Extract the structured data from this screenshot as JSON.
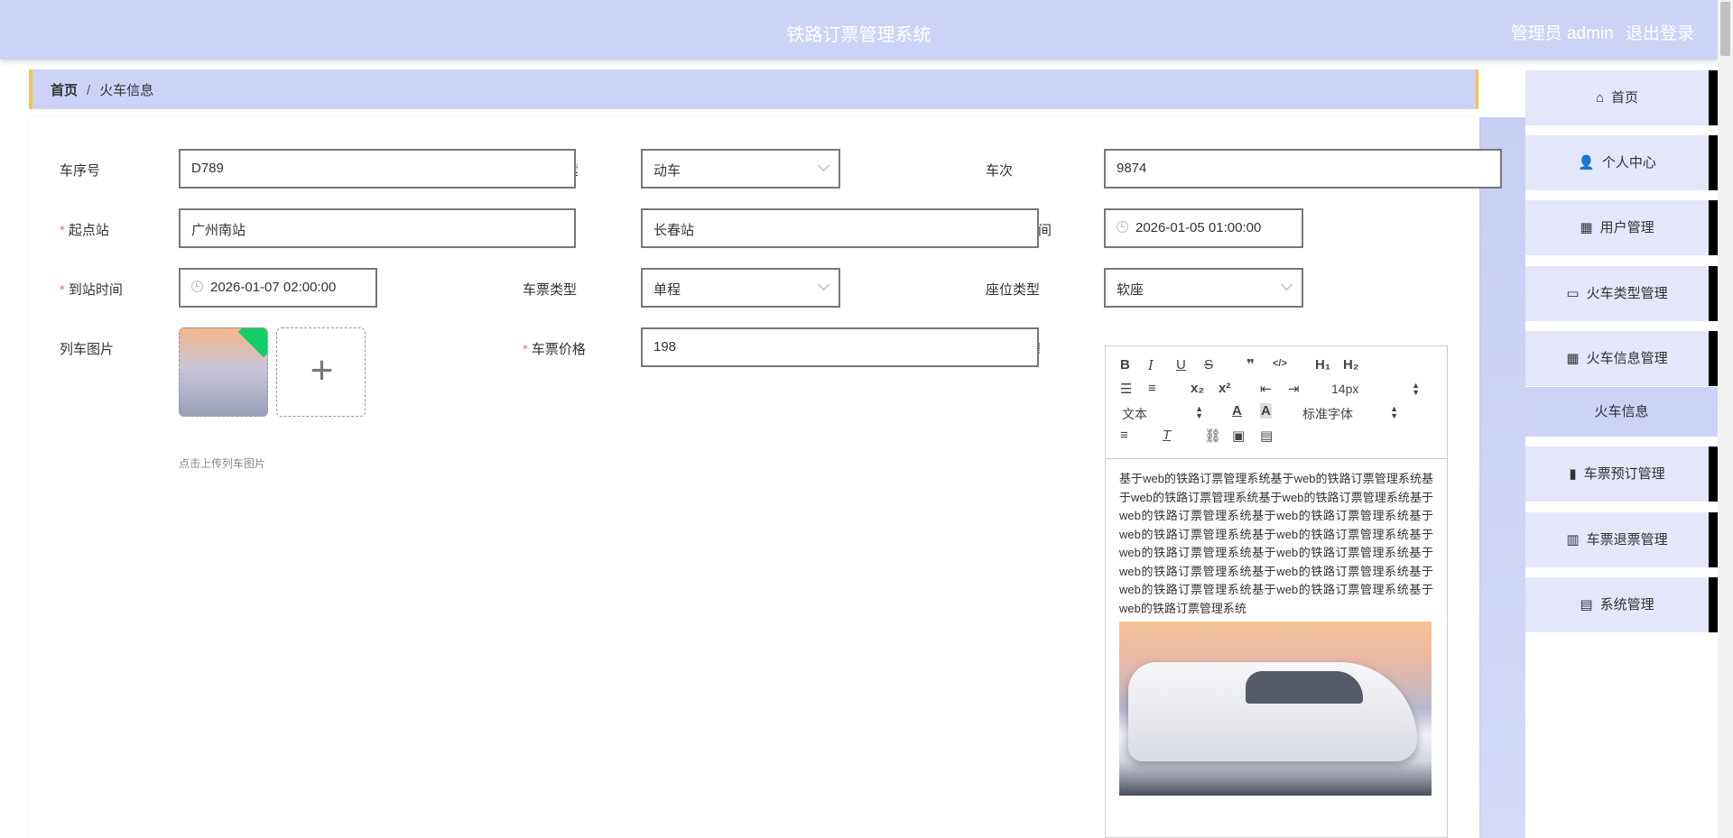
{
  "header": {
    "title": "铁路订票管理系统",
    "role": "管理员 admin",
    "logout": "退出登录"
  },
  "breadcrumb": {
    "home": "首页",
    "separator": "/",
    "current": "火车信息"
  },
  "form": {
    "train_no": {
      "label": "车序号",
      "value": "D789"
    },
    "train_type": {
      "label_tail": "型",
      "value": "动车"
    },
    "train_number": {
      "label": "车次",
      "value": "9874"
    },
    "departure": {
      "label": "起点站",
      "value": "广州南站"
    },
    "arrival_station": {
      "value": "长春站"
    },
    "depart_time": {
      "label_tail": "间",
      "value": "2026-01-05 01:00:00"
    },
    "arrive_time": {
      "label": "到站时间",
      "value": "2026-01-07 02:00:00"
    },
    "ticket_type": {
      "label": "车票类型",
      "value": "单程"
    },
    "seat_type": {
      "label": "座位类型",
      "value": "软座"
    },
    "train_image": {
      "label": "列车图片",
      "tip": "点击上传列车图片"
    },
    "price": {
      "label": "车票价格",
      "value": "198"
    },
    "detail": {
      "label_tail": "情"
    }
  },
  "editor": {
    "toolbar": {
      "bold": "B",
      "italic": "I",
      "underline": "U",
      "strike": "S",
      "blockquote": "❞",
      "code": "</>",
      "h1": "H₁",
      "h2": "H₂",
      "sub": "x₂",
      "sup": "x²",
      "size": "14px",
      "format": "文本",
      "font": "标准字体"
    },
    "content": "基于web的铁路订票管理系统基于web的铁路订票管理系统基于web的铁路订票管理系统基于web的铁路订票管理系统基于web的铁路订票管理系统基于web的铁路订票管理系统基于web的铁路订票管理系统基于web的铁路订票管理系统基于web的铁路订票管理系统基于web的铁路订票管理系统基于web的铁路订票管理系统基于web的铁路订票管理系统基于web的铁路订票管理系统基于web的铁路订票管理系统基于web的铁路订票管理系统"
  },
  "sidebar": {
    "items": [
      {
        "label": "首页",
        "icon": "home-icon"
      },
      {
        "label": "个人中心",
        "icon": "user-icon"
      },
      {
        "label": "用户管理",
        "icon": "grid-icon"
      },
      {
        "label": "火车类型管理",
        "icon": "monitor-icon"
      },
      {
        "label": "火车信息管理",
        "icon": "grid-icon"
      },
      {
        "label": "车票预订管理",
        "icon": "book-icon"
      },
      {
        "label": "车票退票管理",
        "icon": "bar-chart-icon"
      },
      {
        "label": "系统管理",
        "icon": "clipboard-icon"
      }
    ],
    "sub_item": "火车信息"
  }
}
